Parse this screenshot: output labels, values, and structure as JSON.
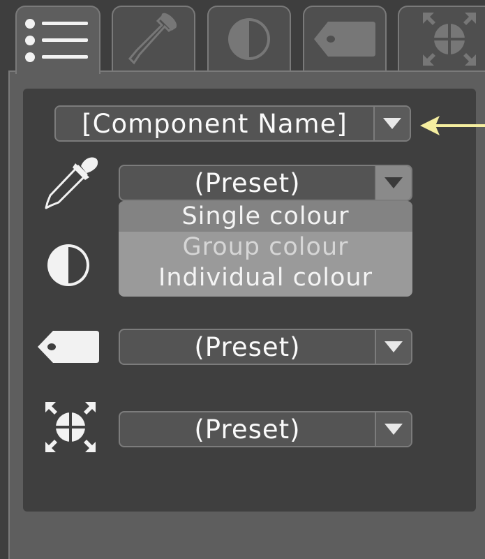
{
  "tabs": [
    {
      "icon": "list-icon",
      "active": true
    },
    {
      "icon": "eyedropper-icon",
      "active": false
    },
    {
      "icon": "contrast-icon",
      "active": false
    },
    {
      "icon": "tag-icon",
      "active": false
    },
    {
      "icon": "scale-icon",
      "active": false
    }
  ],
  "component": {
    "value": "[Component Name]"
  },
  "rows": {
    "colour": {
      "icon": "eyedropper-icon",
      "value": "(Preset)",
      "open": true,
      "options": [
        "Single colour",
        "Group colour",
        "Individual colour"
      ]
    },
    "contrast": {
      "icon": "contrast-icon"
    },
    "label": {
      "icon": "tag-icon",
      "value": "(Preset)"
    },
    "scale": {
      "icon": "scale-icon",
      "value": "(Preset)"
    }
  },
  "colors": {
    "indicator_arrow": "#f5eea0",
    "panel": "#3f3f3f",
    "menu": "#9a9a9a"
  }
}
